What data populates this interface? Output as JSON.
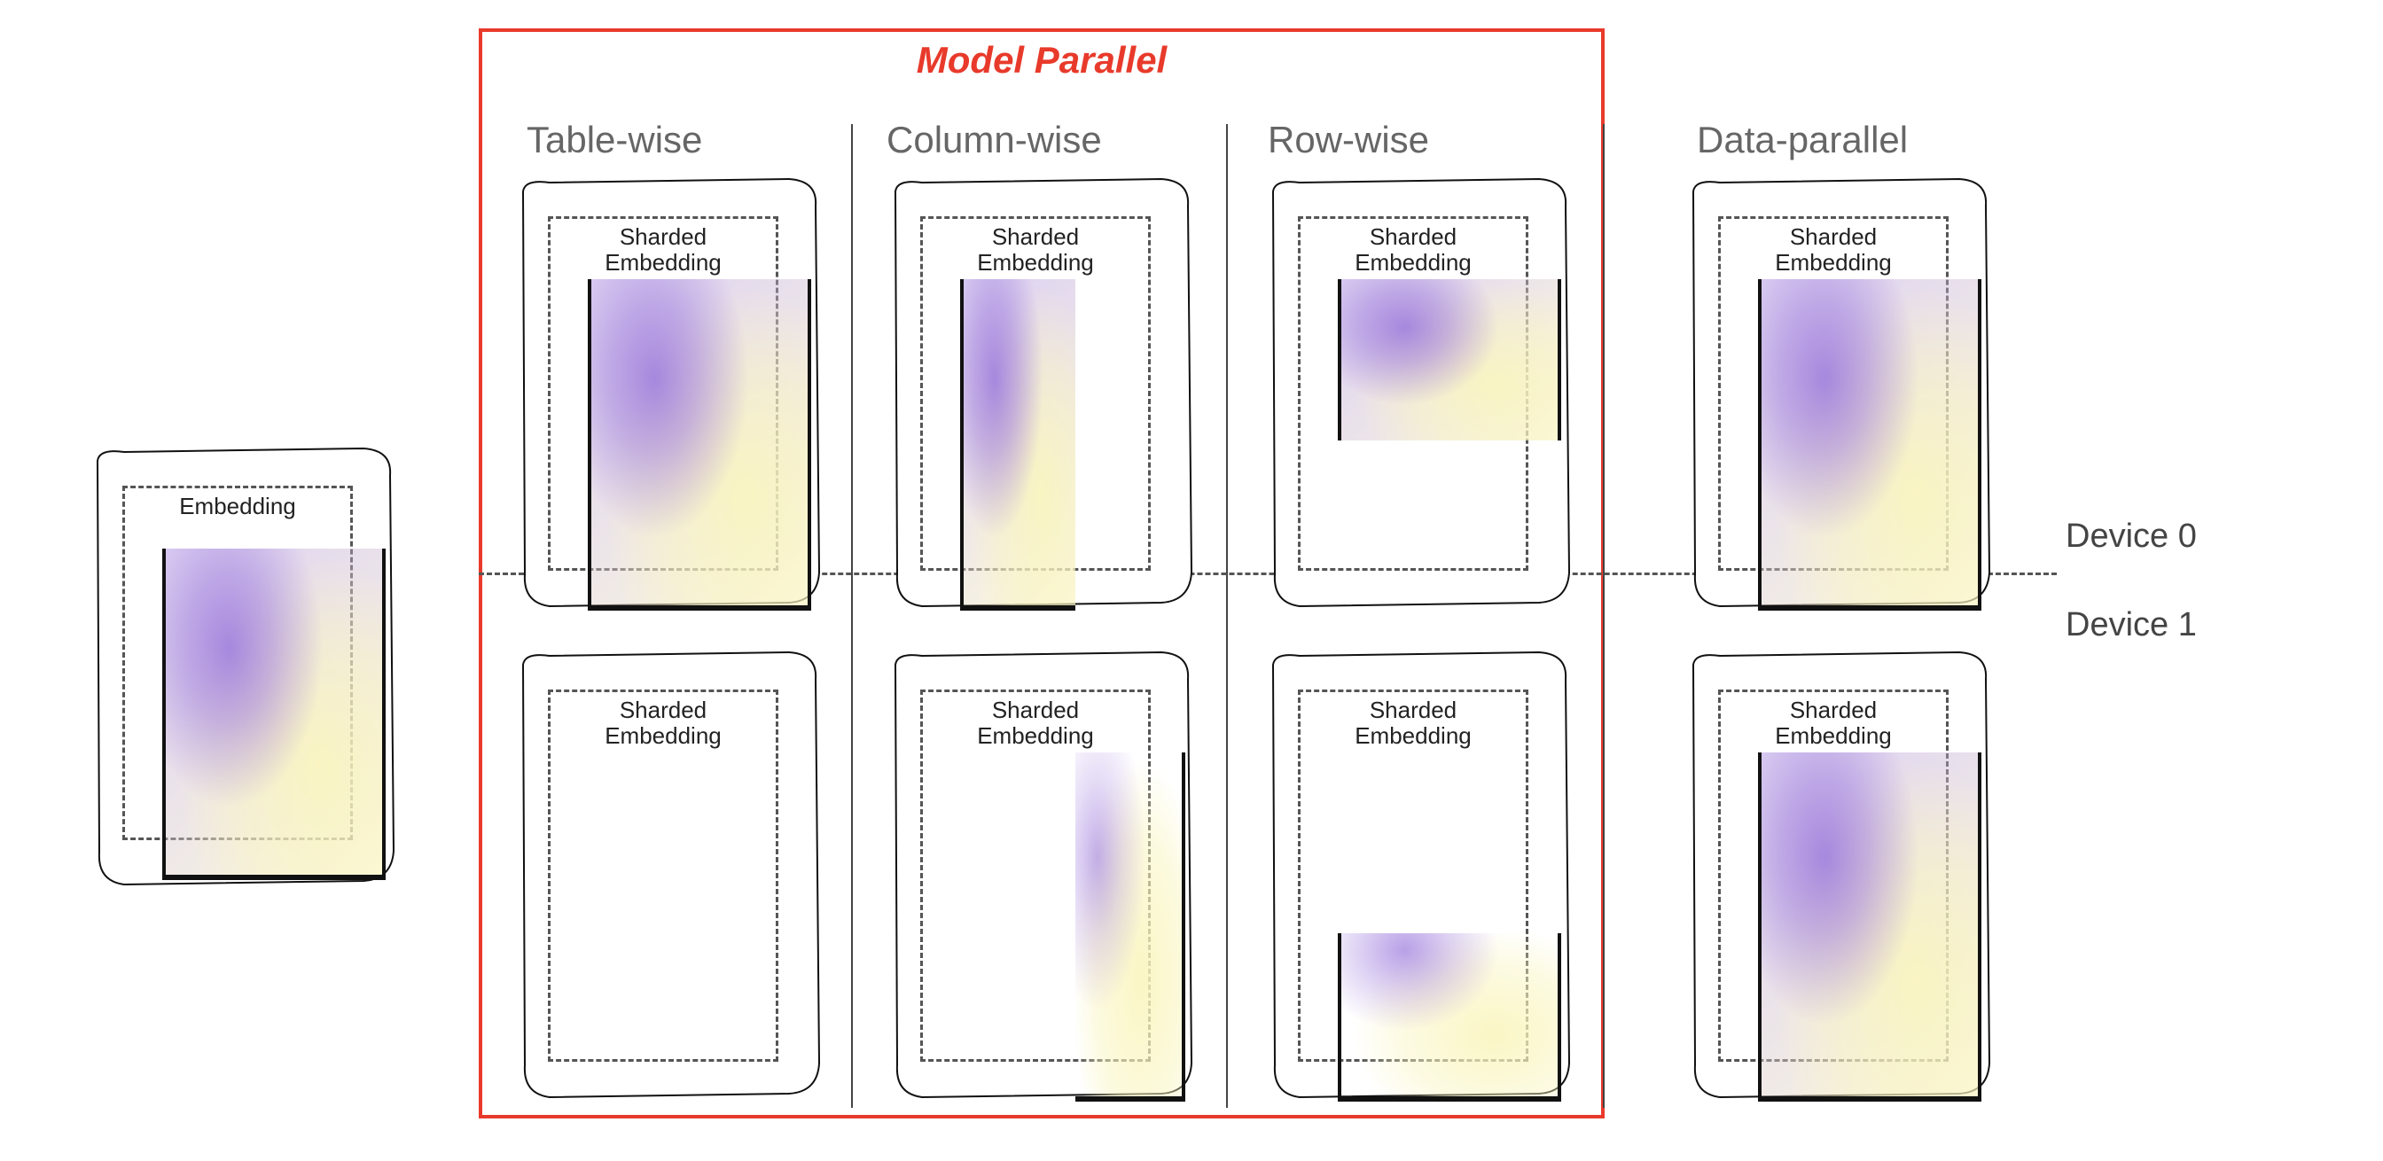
{
  "title": "Model Parallel",
  "columns": {
    "table_wise": "Table-wise",
    "column_wise": "Column-wise",
    "row_wise": "Row-wise",
    "data_parallel": "Data-parallel"
  },
  "devices": {
    "d0": "Device 0",
    "d1": "Device 1"
  },
  "labels": {
    "embedding": "Embedding",
    "sharded_embedding": "Sharded\nEmbedding"
  },
  "variants": {
    "original": {
      "split": "none",
      "devices": 1
    },
    "table_wise": {
      "split": "table",
      "device0": "full",
      "device1": "empty"
    },
    "column_wise": {
      "split": "column",
      "device0": "left",
      "device1": "right"
    },
    "row_wise": {
      "split": "row",
      "device0": "top",
      "device1": "bottom"
    },
    "data_parallel": {
      "split": "replica",
      "device0": "full",
      "device1": "full"
    }
  }
}
